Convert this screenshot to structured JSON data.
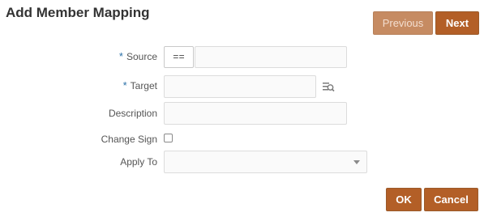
{
  "dialog": {
    "title": "Add Member Mapping"
  },
  "nav": {
    "previous_label": "Previous",
    "next_label": "Next"
  },
  "form": {
    "required_marker": "*",
    "source": {
      "label": "Source",
      "operator": "==",
      "value": ""
    },
    "target": {
      "label": "Target",
      "value": ""
    },
    "description": {
      "label": "Description",
      "value": ""
    },
    "change_sign": {
      "label": "Change Sign",
      "checked": false
    },
    "apply_to": {
      "label": "Apply To",
      "selected": ""
    }
  },
  "footer": {
    "ok_label": "OK",
    "cancel_label": "Cancel"
  },
  "colors": {
    "accent": "#b35f27",
    "accent_disabled": "#c68b62",
    "required": "#2a70a8"
  },
  "icons": {
    "target_lookup": "lookup-icon",
    "apply_to_toggle": "chevron-down-icon"
  }
}
